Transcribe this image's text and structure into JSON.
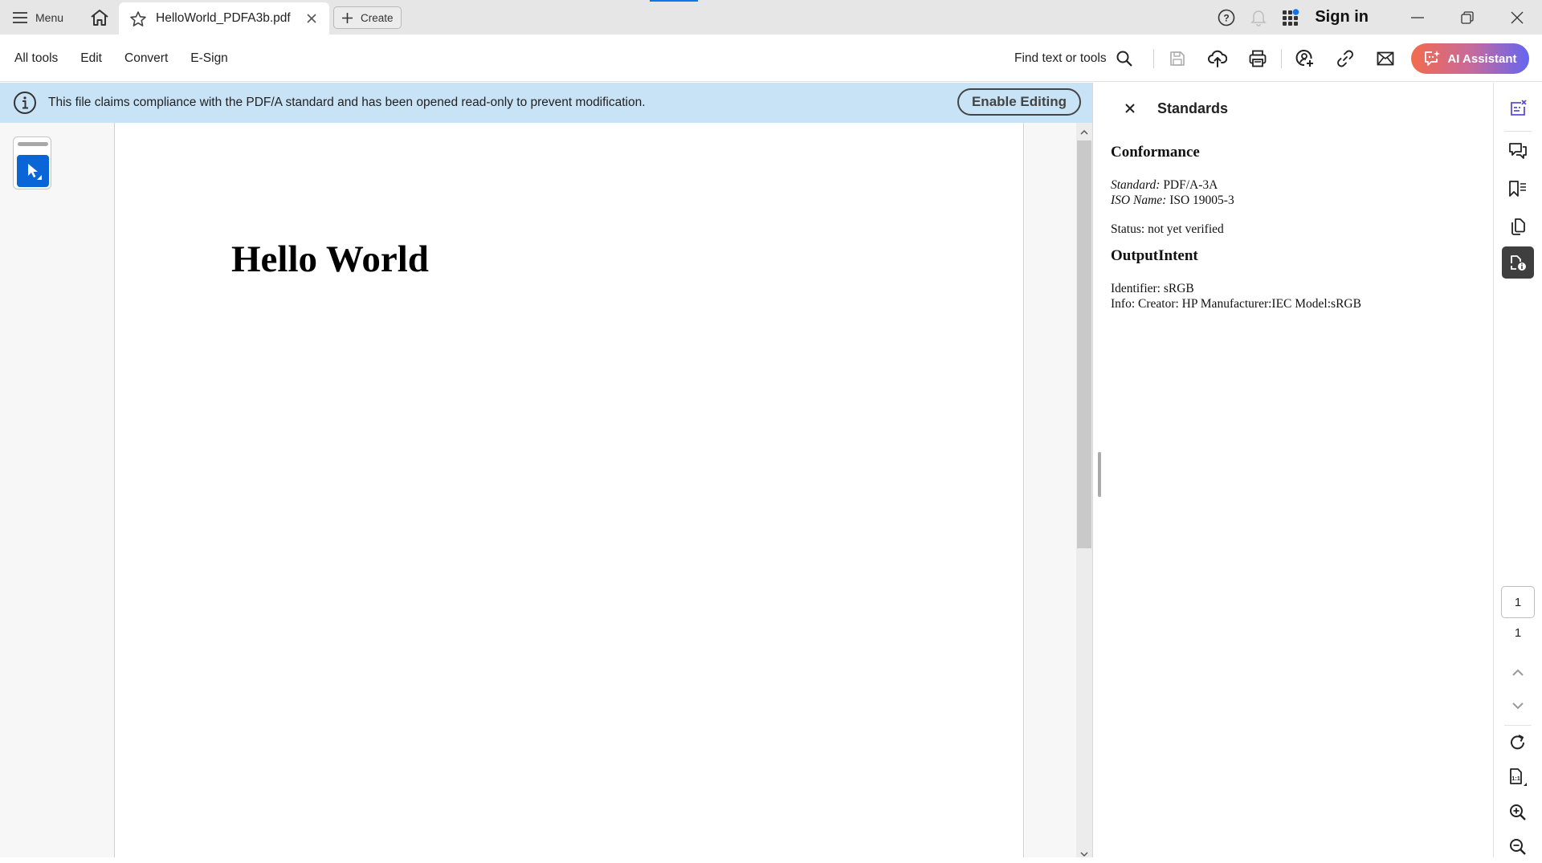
{
  "titlebar": {
    "menu_label": "Menu",
    "tab_title": "HelloWorld_PDFA3b.pdf",
    "create_label": "Create",
    "signin_label": "Sign in",
    "icons": [
      "hamburger-icon",
      "home-icon",
      "star-icon",
      "close-icon",
      "plus-icon",
      "help-icon",
      "bell-icon",
      "apps-grid-icon",
      "minimize-icon",
      "restore-icon",
      "window-close-icon"
    ]
  },
  "toolbar": {
    "menu_items": [
      "All tools",
      "Edit",
      "Convert",
      "E-Sign"
    ],
    "find_label": "Find text or tools",
    "tool_icons": [
      "save-icon",
      "cloud-upload-icon",
      "print-icon",
      "share-user-icon",
      "link-icon",
      "email-icon"
    ],
    "ai_label": "AI Assistant",
    "ai_gradient": [
      "#f26b4e",
      "#c86a9a",
      "#6466f0"
    ]
  },
  "banner": {
    "message": "This file claims compliance with the PDF/A standard and has been opened read-only to prevent modification.",
    "enable_label": "Enable Editing",
    "bg_color": "#c9e3f6"
  },
  "document": {
    "heading": "Hello World"
  },
  "panel": {
    "title": "Standards",
    "conformance": {
      "heading": "Conformance",
      "standard_label": "Standard:",
      "standard_value": "PDF/A-3A",
      "iso_label": "ISO Name:",
      "iso_value": "ISO 19005-3",
      "status": "Status: not yet verified"
    },
    "output_intent": {
      "heading": "OutputIntent",
      "identifier": "Identifier: sRGB",
      "info": "Info: Creator: HP Manufacturer:IEC Model:sRGB"
    }
  },
  "rightrail": {
    "icons": [
      "ai-edit-icon",
      "comment-icon",
      "bookmark-icon",
      "pages-icon",
      "document-properties-icon",
      "rotate-icon",
      "actual-size-icon",
      "zoom-in-icon",
      "zoom-out-icon"
    ],
    "current_page": "1",
    "total_pages": "1",
    "accent": "#5b4fd6"
  }
}
